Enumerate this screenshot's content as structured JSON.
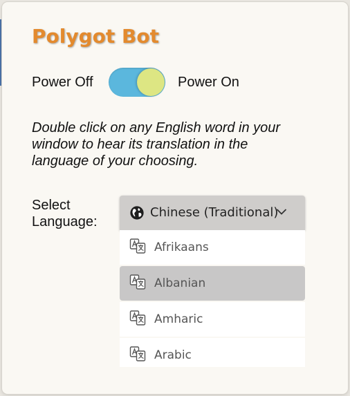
{
  "app": {
    "title": "Polygot Bot"
  },
  "power": {
    "off_label": "Power Off",
    "on_label": "Power On",
    "state": "on"
  },
  "description": "Double click on any English word in your window to hear its translation in the language of your choosing.",
  "language": {
    "label_line1": "Select",
    "label_line2": "Language:",
    "selected": "Chinese (Traditional)",
    "selected_icon": "globe-icon",
    "options": [
      {
        "label": "Afrikaans",
        "icon": "translate-icon"
      },
      {
        "label": "Albanian",
        "icon": "translate-icon",
        "highlighted": true
      },
      {
        "label": "Amharic",
        "icon": "translate-icon"
      },
      {
        "label": "Arabic",
        "icon": "translate-icon"
      }
    ]
  },
  "colors": {
    "title": "#e38a2e",
    "toggle_track": "#5bb7dd",
    "toggle_knob": "#dde683",
    "highlight": "#c8c7c7"
  }
}
